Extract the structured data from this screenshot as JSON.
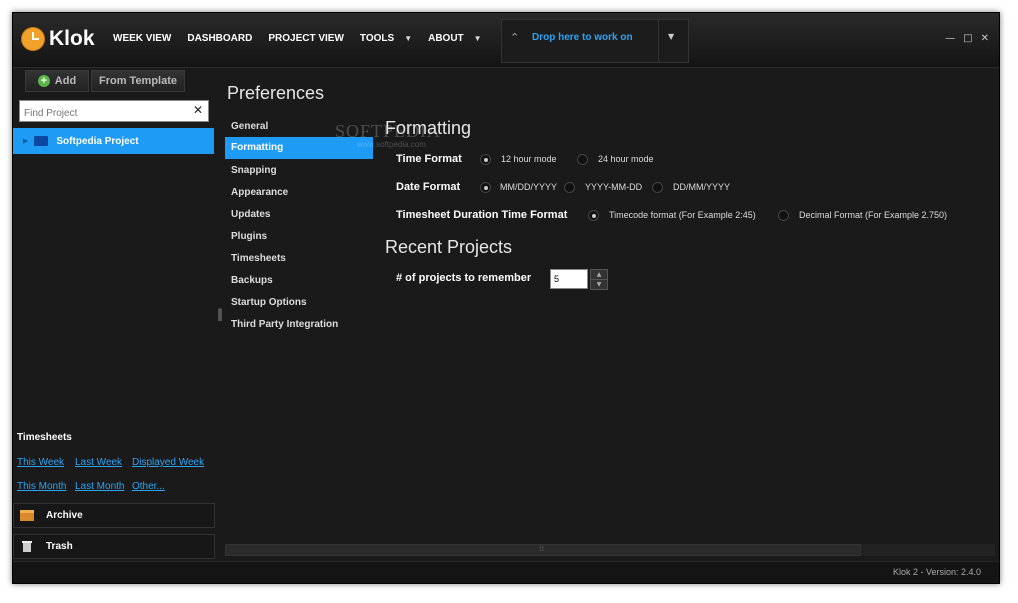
{
  "app": {
    "name": "Klok"
  },
  "nav": [
    {
      "label": "WEEK VIEW"
    },
    {
      "label": "DASHBOARD"
    },
    {
      "label": "PROJECT VIEW"
    },
    {
      "label": "TOOLS"
    },
    {
      "label": "ABOUT"
    }
  ],
  "dropzone": {
    "label": "Drop here to work on"
  },
  "sidebar": {
    "add_label": "Add",
    "template_label": "From Template",
    "search_placeholder": "Find Project",
    "project": "Softpedia Project",
    "timesheets_title": "Timesheets",
    "links": [
      "This Week",
      "Last Week",
      "Displayed Week",
      "This Month",
      "Last Month",
      "Other..."
    ],
    "archive": "Archive",
    "trash": "Trash"
  },
  "prefs": {
    "title": "Preferences",
    "menu": [
      "General",
      "Formatting",
      "Snapping",
      "Appearance",
      "Updates",
      "Plugins",
      "Timesheets",
      "Backups",
      "Startup Options",
      "Third Party Integration"
    ],
    "active": "Formatting"
  },
  "formatting": {
    "title": "Formatting",
    "time_format_label": "Time Format",
    "time_options": [
      "12 hour mode",
      "24 hour mode"
    ],
    "date_format_label": "Date Format",
    "date_options": [
      "MM/DD/YYYY",
      "YYYY-MM-DD",
      "DD/MM/YYYY"
    ],
    "ts_duration_label": "Timesheet Duration Time Format",
    "ts_options": [
      "Timecode format (For Example 2:45)",
      "Decimal Format (For Example 2.750)"
    ]
  },
  "recent": {
    "title": "Recent Projects",
    "label": "# of projects to remember",
    "value": "5"
  },
  "status": {
    "version": "Klok 2 - Version: 2.4.0"
  },
  "watermark": {
    "line1": "SOFTPEDIA",
    "line2": "www.softpedia.com"
  }
}
